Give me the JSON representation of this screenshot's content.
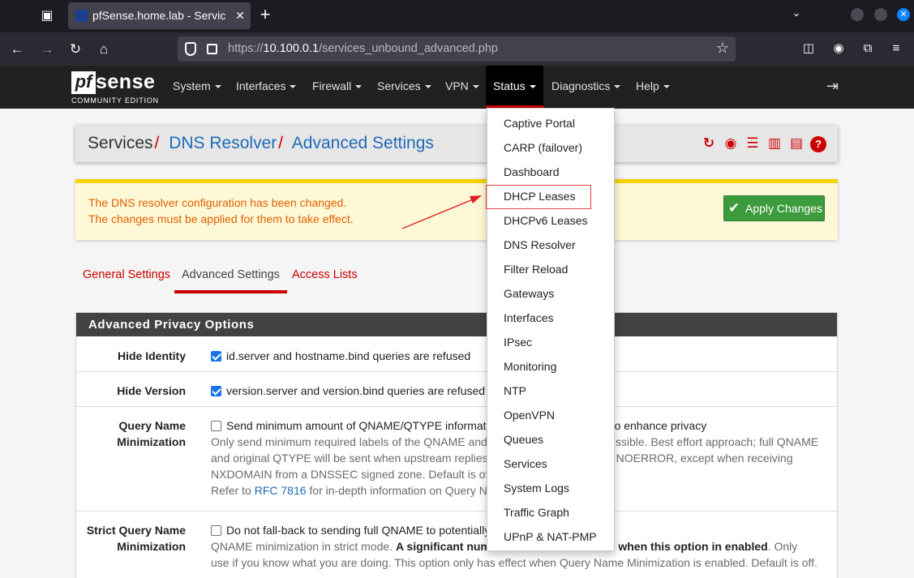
{
  "browser": {
    "tab_title": "pfSense.home.lab - Servic",
    "url_prefix": "https://",
    "url_host": "10.100.0.1",
    "url_path": "/services_unbound_advanced.php"
  },
  "nav": {
    "logo_text": "sense",
    "logo_letter": "pf",
    "logo_sub": "COMMUNITY EDITION",
    "items": [
      "System",
      "Interfaces",
      "Firewall",
      "Services",
      "VPN",
      "Status",
      "Diagnostics",
      "Help"
    ]
  },
  "breadcrumb": {
    "root": "Services",
    "level1": "DNS Resolver",
    "level2": "Advanced Settings"
  },
  "alert": {
    "line1": "The DNS resolver configuration has been changed.",
    "line2": "The changes must be applied for them to take effect.",
    "apply_label": "Apply Changes"
  },
  "tabs": [
    "General Settings",
    "Advanced Settings",
    "Access Lists"
  ],
  "section": {
    "title": "Advanced Privacy Options",
    "rows": [
      {
        "label": "Hide Identity",
        "checkbox_text": "id.server and hostname.bind queries are refused",
        "checked": true
      },
      {
        "label": "Hide Version",
        "checkbox_text": "version.server and version.bind queries are refused",
        "checked": true
      },
      {
        "label_l1": "Query Name",
        "label_l2": "Minimization",
        "checkbox_text": "Send minimum amount of QNAME/QTYPE informat",
        "checkbox_tail": "o enhance privacy",
        "help_l1": "Only send minimum required labels of the QNAME and",
        "help_l1_tail": "ssible. Best effort approach; full QNAME",
        "help_l2": "and original QTYPE will be sent when upstream replies",
        "help_l2_tail": "NOERROR, except when receiving",
        "help_l3": "NXDOMAIN from a DNSSEC signed zone. Default is off",
        "help_l4_pre": "Refer to ",
        "help_link": "RFC 7816",
        "help_l4_post": " for in-depth information on Query Na",
        "checked": false
      },
      {
        "label_l1": "Strict Query Name",
        "label_l2": "Minimization",
        "checkbox_text": "Do not fall-back to sending full QNAME to potentially",
        "help_l1_pre": "QNAME minimization in strict mode. ",
        "help_l1_bold": "A significant numb",
        "help_l1_bold_tail": "resolve when this option in enabled",
        "help_l1_post": ". Only",
        "help_l2": "use if you know what you are doing. This option only has effect when Query Name Minimization is enabled. Default is off.",
        "checked": false
      }
    ]
  },
  "status_menu": [
    "Captive Portal",
    "CARP (failover)",
    "Dashboard",
    "DHCP Leases",
    "DHCPv6 Leases",
    "DNS Resolver",
    "Filter Reload",
    "Gateways",
    "Interfaces",
    "IPsec",
    "Monitoring",
    "NTP",
    "OpenVPN",
    "Queues",
    "Services",
    "System Logs",
    "Traffic Graph",
    "UPnP & NAT-PMP"
  ],
  "colors": {
    "accent": "#cc0000",
    "link": "#1e6bb8",
    "alert_text": "#e06000",
    "apply": "#3c9b3c"
  }
}
